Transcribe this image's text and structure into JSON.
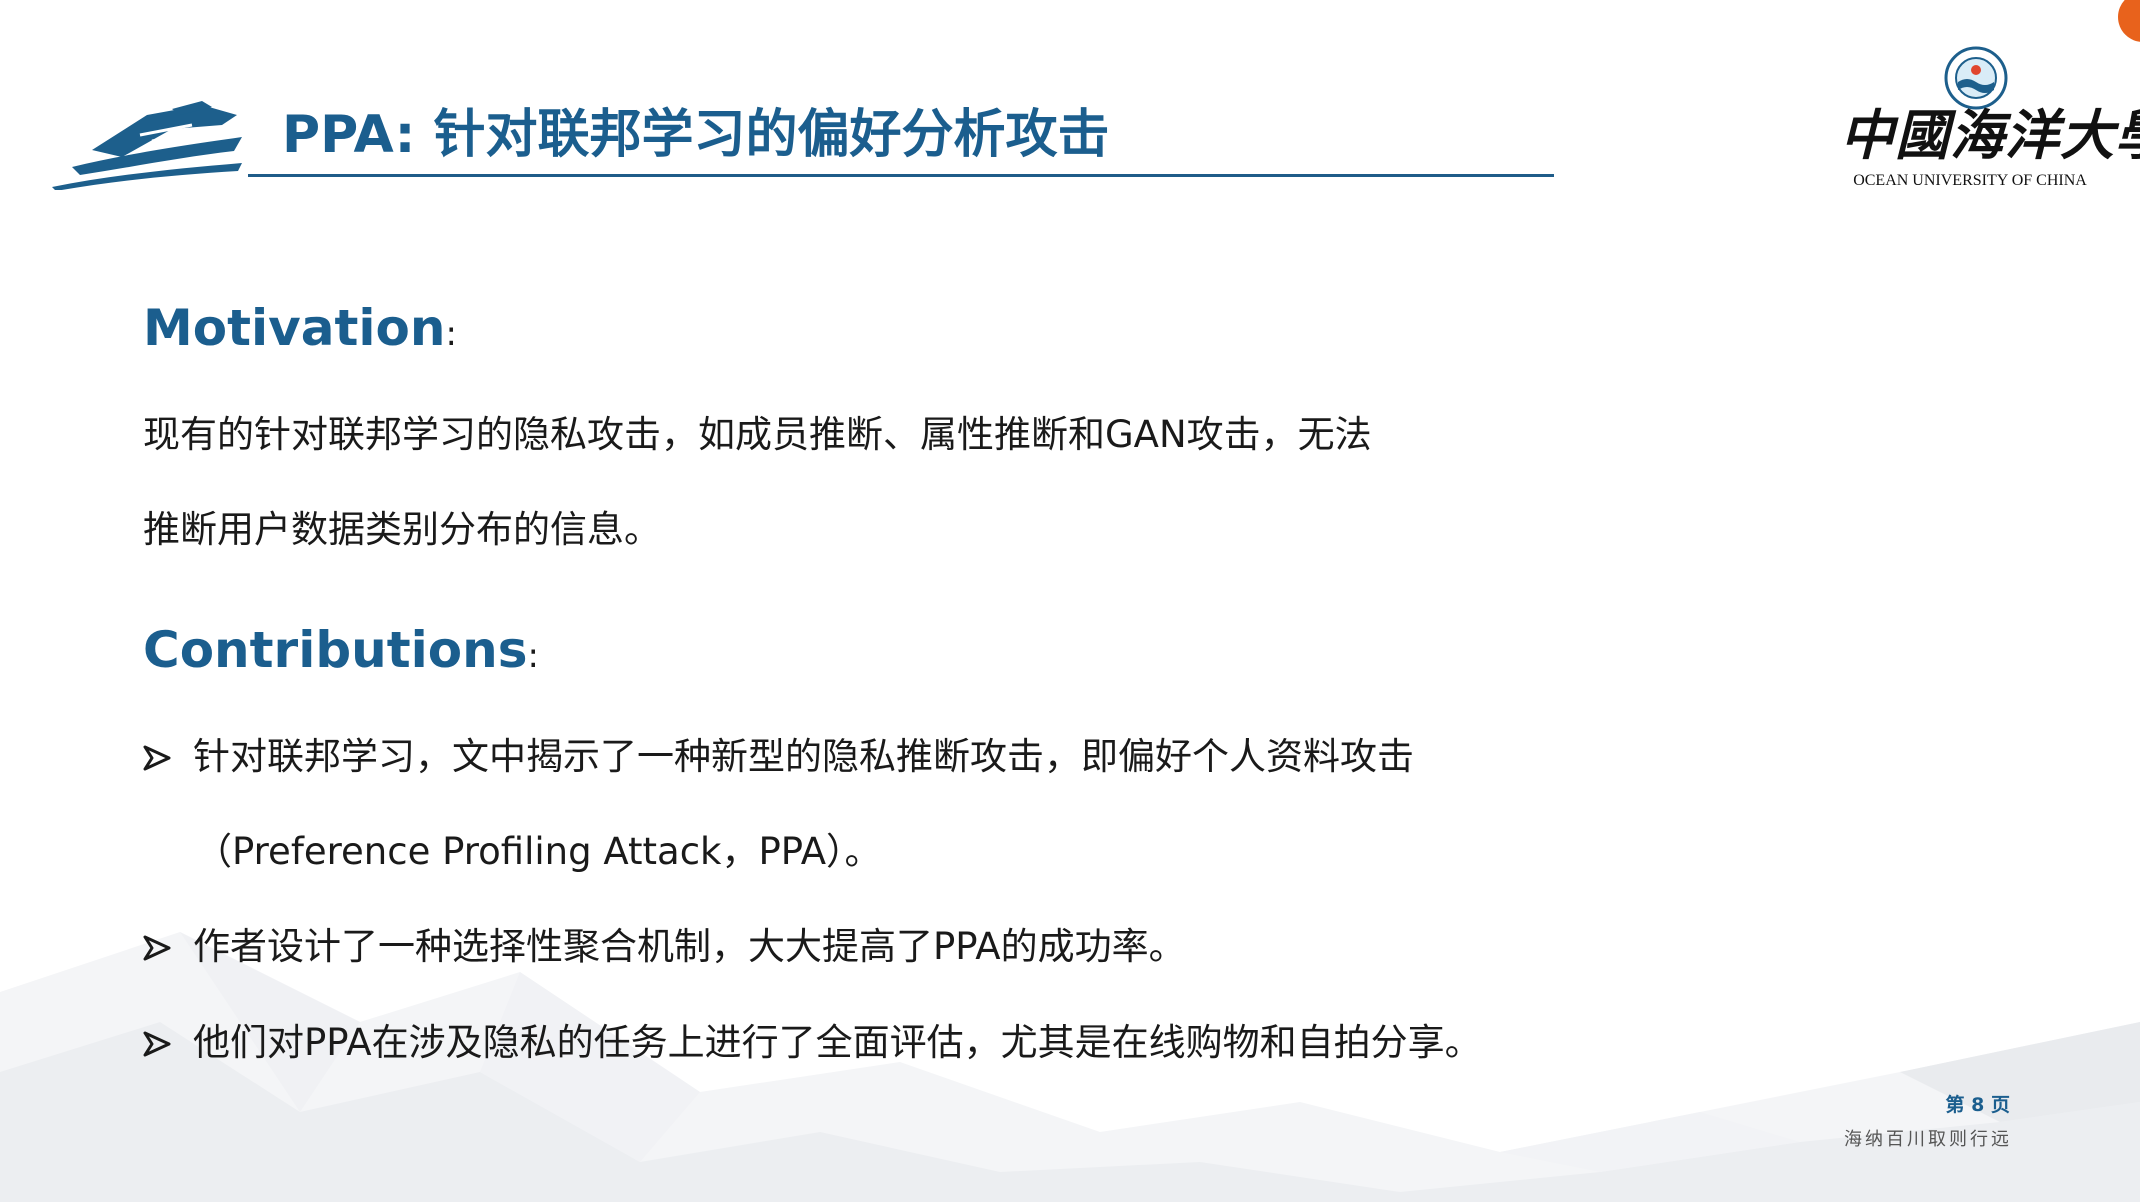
{
  "header": {
    "title": "PPA: 针对联邦学习的偏好分析攻击",
    "logo_icon": "ship-icon"
  },
  "university": {
    "name_calligraphy": "中國海洋大學",
    "name_english": "OCEAN UNIVERSITY OF CHINA",
    "emblem_icon": "university-emblem-icon"
  },
  "sections": {
    "motivation": {
      "heading": "Motivation",
      "colon": ":",
      "lines": [
        "现有的针对联邦学习的隐私攻击，如成员推断、属性推断和GAN攻击，无法",
        "推断用户数据类别分布的信息。"
      ]
    },
    "contributions": {
      "heading": "Contributions",
      "colon": ":",
      "bullet_icon": "arrow-bullet-icon",
      "items": [
        {
          "text": "针对联邦学习，文中揭示了一种新型的隐私推断攻击，即偏好个人资料攻击",
          "continuation": "（Preference Profiling Attack，PPA）。"
        },
        {
          "text": "作者设计了一种选择性聚合机制，大大提高了PPA的成功率。"
        },
        {
          "text": "他们对PPA在涉及隐私的任务上进行了全面评估，尤其是在线购物和自拍分享。"
        }
      ]
    }
  },
  "footer": {
    "page_label": "第 8 页",
    "motto": "海纳百川取则行远"
  },
  "colors": {
    "accent": "#1b5e8e",
    "text": "#1a1a1a",
    "badge": "#e8621c"
  }
}
